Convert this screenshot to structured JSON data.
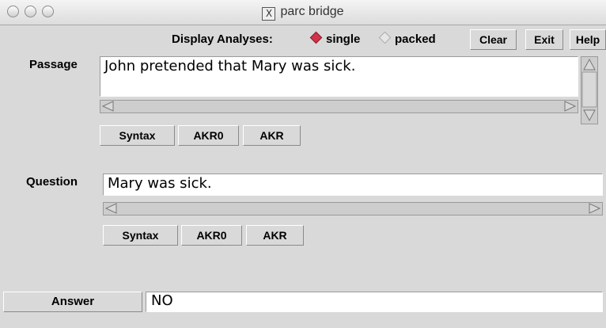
{
  "window": {
    "title": "parc bridge"
  },
  "toolbar": {
    "display_label": "Display Analyses:",
    "options": [
      {
        "label": "single",
        "selected": true
      },
      {
        "label": "packed",
        "selected": false
      }
    ],
    "clear_label": "Clear",
    "exit_label": "Exit",
    "help_label": "Help"
  },
  "passage": {
    "label": "Passage",
    "text": "John pretended that Mary was sick.",
    "buttons": [
      "Syntax",
      "AKR0",
      "AKR"
    ]
  },
  "question": {
    "label": "Question",
    "text": "Mary was sick.",
    "buttons": [
      "Syntax",
      "AKR0",
      "AKR"
    ]
  },
  "answer": {
    "button_label": "Answer",
    "value": "NO"
  },
  "colors": {
    "selected_radio": "#d0344a",
    "unselected_radio": "#e6e6e6"
  }
}
